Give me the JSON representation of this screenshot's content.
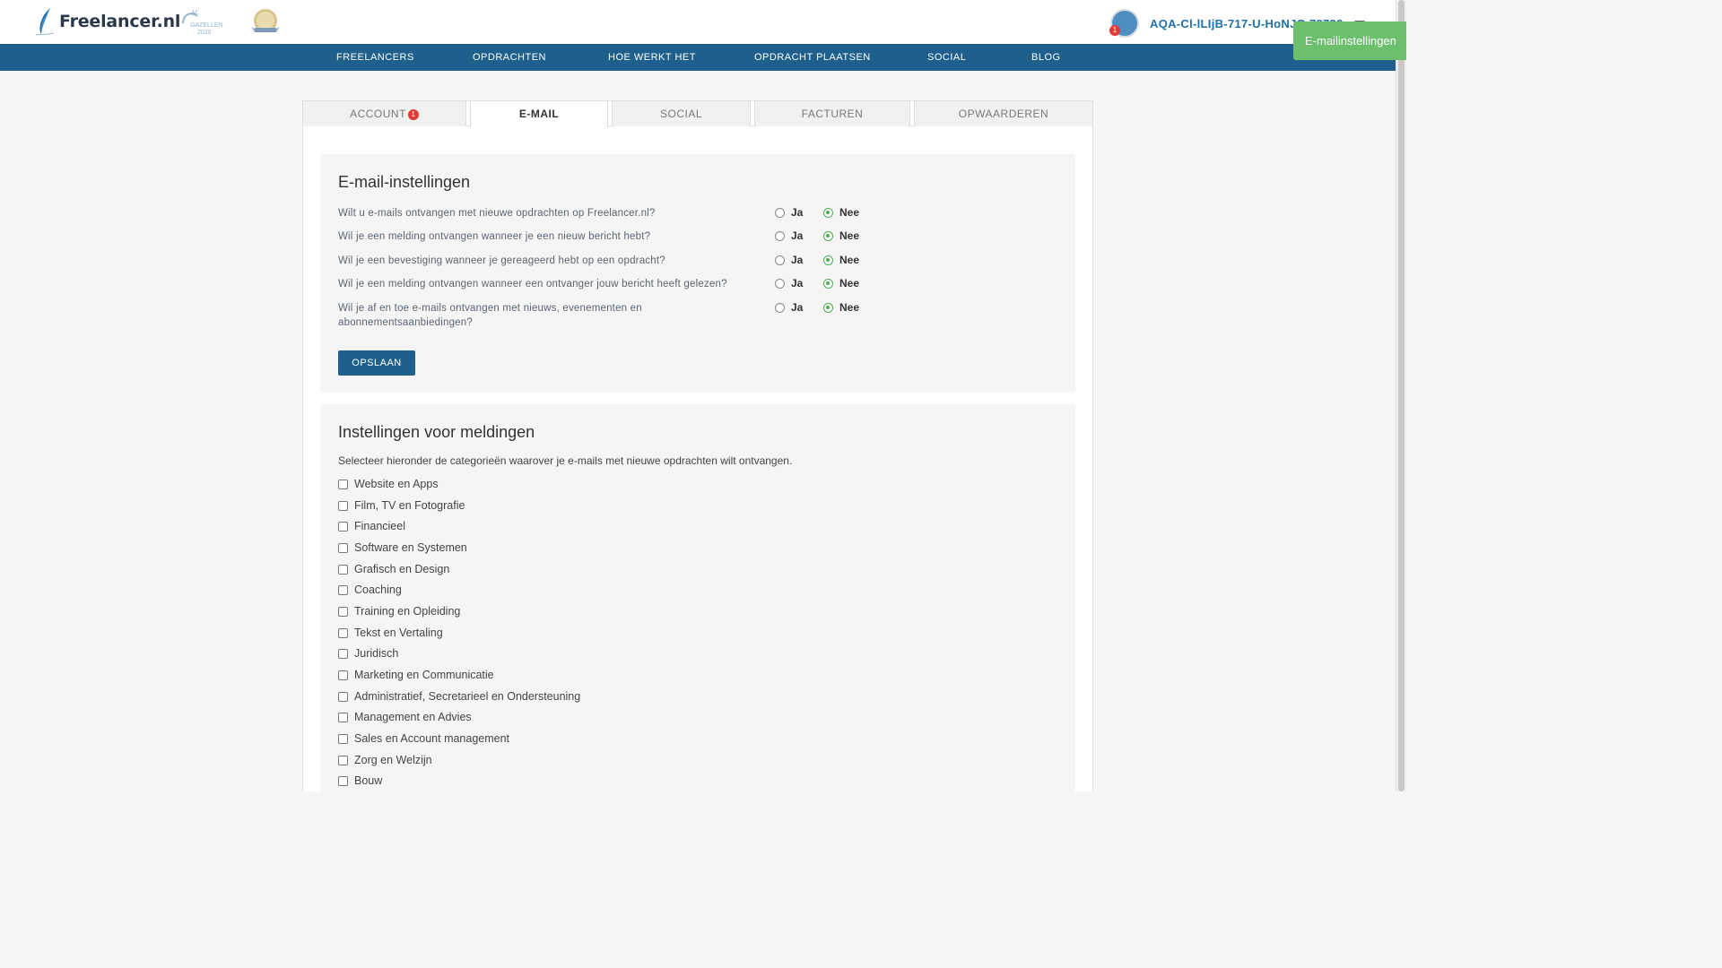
{
  "header": {
    "logo_text": "Freelancer.nl",
    "badge_gazellen_text": "GAZELLEN",
    "badge_gazellen_year": "2020",
    "username": "AQA-Cl-lLIjB-717-U-HoNJG 78723",
    "notification_count": "1"
  },
  "toast": {
    "text": "E-mailinstellingen"
  },
  "nav": {
    "items": [
      "FREELANCERS",
      "OPDRACHTEN",
      "HOE WERKT HET",
      "OPDRACHT PLAATSEN",
      "SOCIAL",
      "BLOG"
    ]
  },
  "tabs": {
    "account": "ACCOUNT",
    "account_badge": "1",
    "email": "E-MAIL",
    "social": "SOCIAL",
    "facturen": "FACTUREN",
    "opwaarderen": "OPWAARDEREN",
    "active": "E-MAIL"
  },
  "email_settings": {
    "title": "E-mail-instellingen",
    "yes_label": "Ja",
    "no_label": "Nee",
    "questions": [
      {
        "text": "Wilt u e-mails ontvangen met nieuwe opdrachten op Freelancer.nl?",
        "selected": "Nee"
      },
      {
        "text": "Wil je een melding ontvangen wanneer je een nieuw bericht hebt?",
        "selected": "Nee"
      },
      {
        "text": "Wil je een bevestiging wanneer je gereageerd hebt op een opdracht?",
        "selected": "Nee"
      },
      {
        "text": "Wil je een melding ontvangen wanneer een ontvanger jouw bericht heeft gelezen?",
        "selected": "Nee"
      },
      {
        "text": "Wil je af en toe e-mails ontvangen met nieuws, evenementen en abonnementsaanbiedingen?",
        "selected": "Nee"
      }
    ],
    "save_label": "OPSLAAN"
  },
  "notifications": {
    "title": "Instellingen voor meldingen",
    "description": "Selecteer hieronder de categorieën waarover je e-mails met nieuwe opdrachten wilt ontvangen.",
    "categories": [
      {
        "label": "Website en Apps",
        "checked": false
      },
      {
        "label": "Film, TV en Fotografie",
        "checked": false
      },
      {
        "label": "Financieel",
        "checked": false
      },
      {
        "label": "Software en Systemen",
        "checked": false
      },
      {
        "label": "Grafisch en Design",
        "checked": false
      },
      {
        "label": "Coaching",
        "checked": false
      },
      {
        "label": "Training en Opleiding",
        "checked": false
      },
      {
        "label": "Tekst en Vertaling",
        "checked": false
      },
      {
        "label": "Juridisch",
        "checked": false
      },
      {
        "label": "Marketing en Communicatie",
        "checked": false
      },
      {
        "label": "Administratief, Secretarieel en Ondersteuning",
        "checked": false
      },
      {
        "label": "Management en Advies",
        "checked": false
      },
      {
        "label": "Sales en Account management",
        "checked": false
      },
      {
        "label": "Zorg en Welzijn",
        "checked": false
      },
      {
        "label": "Bouw",
        "checked": false
      }
    ]
  },
  "colors": {
    "nav_bg": "#1f5f8b",
    "toast_bg": "#6cc06d",
    "selected_radio": "#4caf50",
    "badge_red": "#e53935"
  }
}
